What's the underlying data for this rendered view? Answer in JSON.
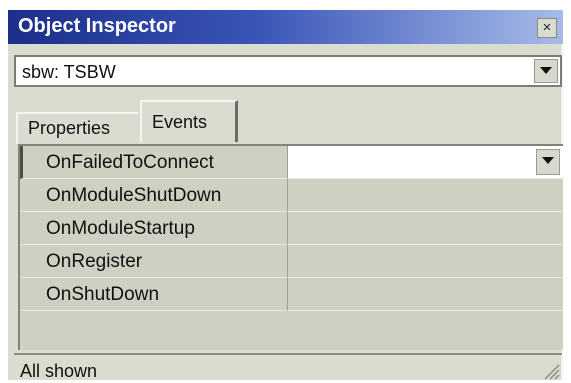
{
  "window": {
    "title": "Object Inspector",
    "close_glyph": "×"
  },
  "object_selector": {
    "value": "sbw: TSBW",
    "icon": "chevron-down-icon"
  },
  "tabs": [
    {
      "label": "Properties",
      "active": false
    },
    {
      "label": "Events",
      "active": true
    }
  ],
  "events": [
    {
      "name": "OnFailedToConnect",
      "value": "",
      "selected": true
    },
    {
      "name": "OnModuleShutDown",
      "value": "",
      "selected": false
    },
    {
      "name": "OnModuleStartup",
      "value": "",
      "selected": false
    },
    {
      "name": "OnRegister",
      "value": "",
      "selected": false
    },
    {
      "name": "OnShutDown",
      "value": "",
      "selected": false
    }
  ],
  "statusbar": {
    "text": "All shown",
    "grip_icon": "resize-grip-icon"
  },
  "colors": {
    "title_gradient_start": "#1b2f8a",
    "title_gradient_end": "#a6bbe8",
    "window_face": "#d9ddcf",
    "selected_value_bg": "#ffffff"
  }
}
